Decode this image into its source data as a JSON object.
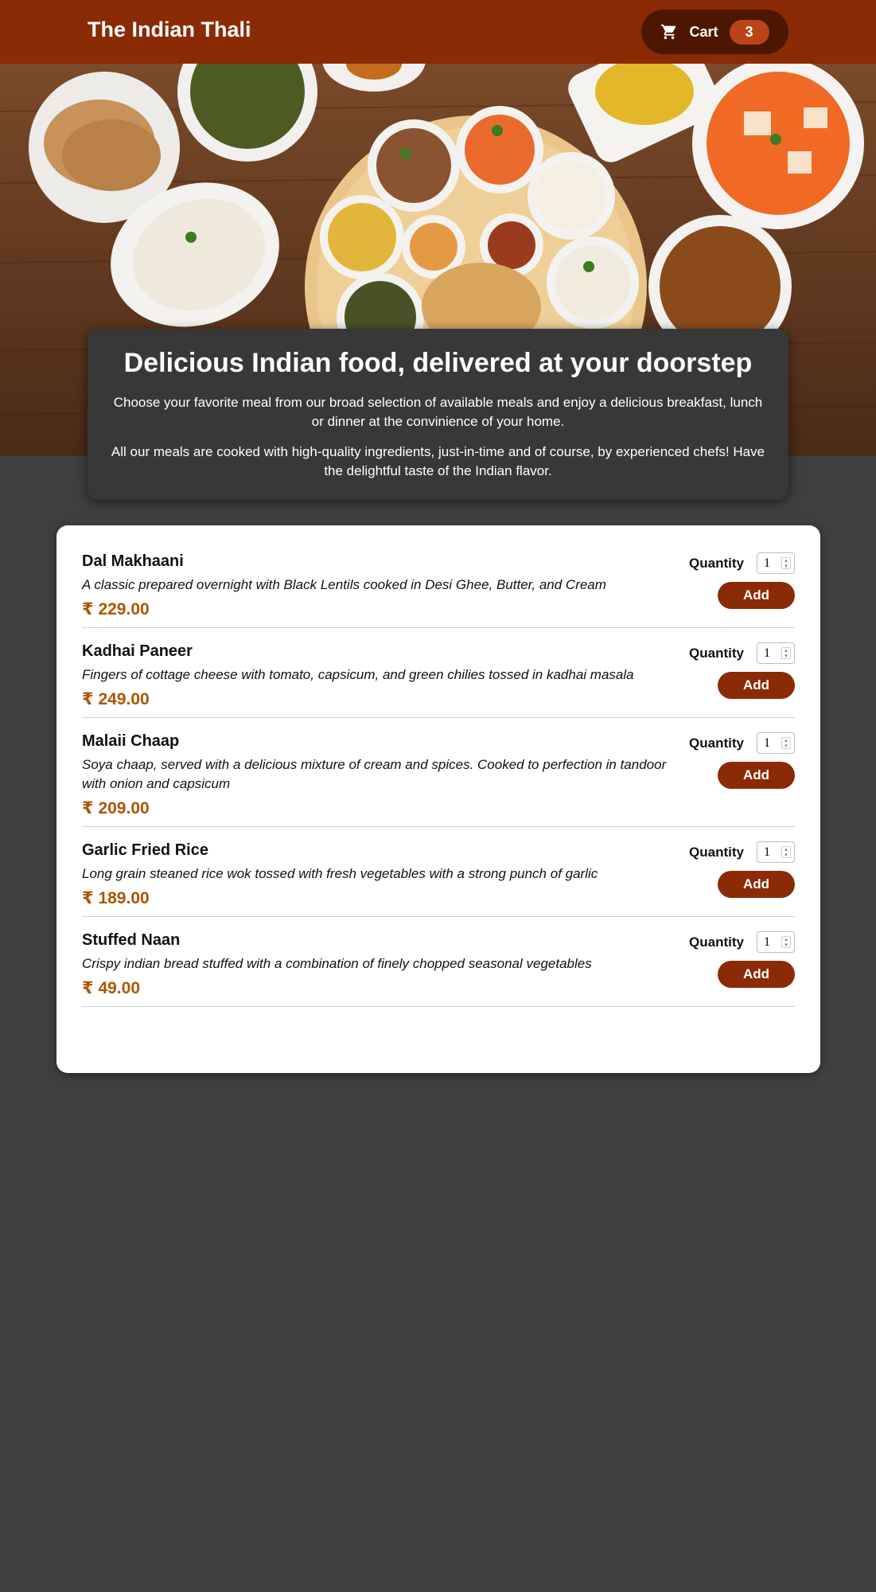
{
  "header": {
    "title": "The Indian Thali",
    "cart_label": "Cart",
    "cart_count": "3",
    "cart_icon": "cart-icon"
  },
  "summary": {
    "heading": "Delicious Indian food, delivered at your doorstep",
    "paragraph1": "Choose your favorite meal from our broad selection of available meals and enjoy a delicious breakfast, lunch or dinner at the convinience of your home.",
    "paragraph2": "All our meals are cooked with high-quality ingredients, just-in-time and of course, by experienced chefs! Have the delightful taste of the Indian flavor."
  },
  "meals": [
    {
      "name": "Dal Makhaani",
      "description": "A classic prepared overnight with Black Lentils cooked in Desi Ghee, Butter, and Cream",
      "price": "₹ 229.00",
      "quantity_label": "Quantity",
      "quantity": "1",
      "add_label": "Add"
    },
    {
      "name": "Kadhai Paneer",
      "description": "Fingers of cottage cheese with tomato, capsicum, and green chilies tossed in kadhai masala",
      "price": "₹ 249.00",
      "quantity_label": "Quantity",
      "quantity": "1",
      "add_label": "Add"
    },
    {
      "name": "Malaii Chaap",
      "description": "Soya chaap, served with a delicious mixture of cream and spices. Cooked to perfection in tandoor with onion and capsicum",
      "price": "₹ 209.00",
      "quantity_label": "Quantity",
      "quantity": "1",
      "add_label": "Add"
    },
    {
      "name": "Garlic Fried Rice",
      "description": "Long grain steaned rice wok tossed with fresh vegetables with a strong punch of garlic",
      "price": "₹ 189.00",
      "quantity_label": "Quantity",
      "quantity": "1",
      "add_label": "Add"
    },
    {
      "name": "Stuffed Naan",
      "description": "Crispy indian bread stuffed with a combination of finely chopped seasonal vegetables",
      "price": "₹ 49.00",
      "quantity_label": "Quantity",
      "quantity": "1",
      "add_label": "Add"
    }
  ],
  "colors": {
    "header": "#8a2b06",
    "cart_bg": "#4d1601",
    "badge": "#b94517",
    "page_bg": "#3f3f3f",
    "summary_bg": "#383838",
    "price": "#ad5502",
    "add_button": "#8a2b06"
  }
}
